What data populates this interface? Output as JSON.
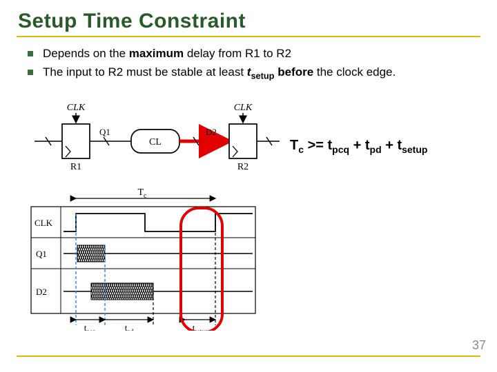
{
  "title": "Setup Time Constraint",
  "bullets": [
    {
      "pre": "Depends on the ",
      "bold1": "maximum",
      "post": " delay from R1 to R2"
    },
    {
      "pre": "The input to R2 must be stable at least ",
      "term": "t",
      "termsub": "setup",
      "bold2": " before",
      "post2": " the clock edge."
    }
  ],
  "inequality": {
    "Tc": "T",
    "Tcs": "c",
    "ge": " >= ",
    "t1": "t",
    "t1s": "pcq",
    "plus": " + ",
    "t2": "t",
    "t2s": "pd",
    "t3": "t",
    "t3s": "setup"
  },
  "labels": {
    "CLK1": "CLK",
    "CLK2": "CLK",
    "Q1": "Q1",
    "D2": "D2",
    "CL": "CL",
    "R1": "R1",
    "R2": "R2",
    "Tc": "T",
    "Tc_sub": "c",
    "CLK_td": "CLK",
    "Q1_td": "Q1",
    "D2_td": "D2",
    "tpcq": "t",
    "tpcq_sub": "pcq",
    "tpd": "t",
    "tpd_sub": "pd",
    "tsetup": "t",
    "tsetup_sub": "setup"
  },
  "page": "37"
}
